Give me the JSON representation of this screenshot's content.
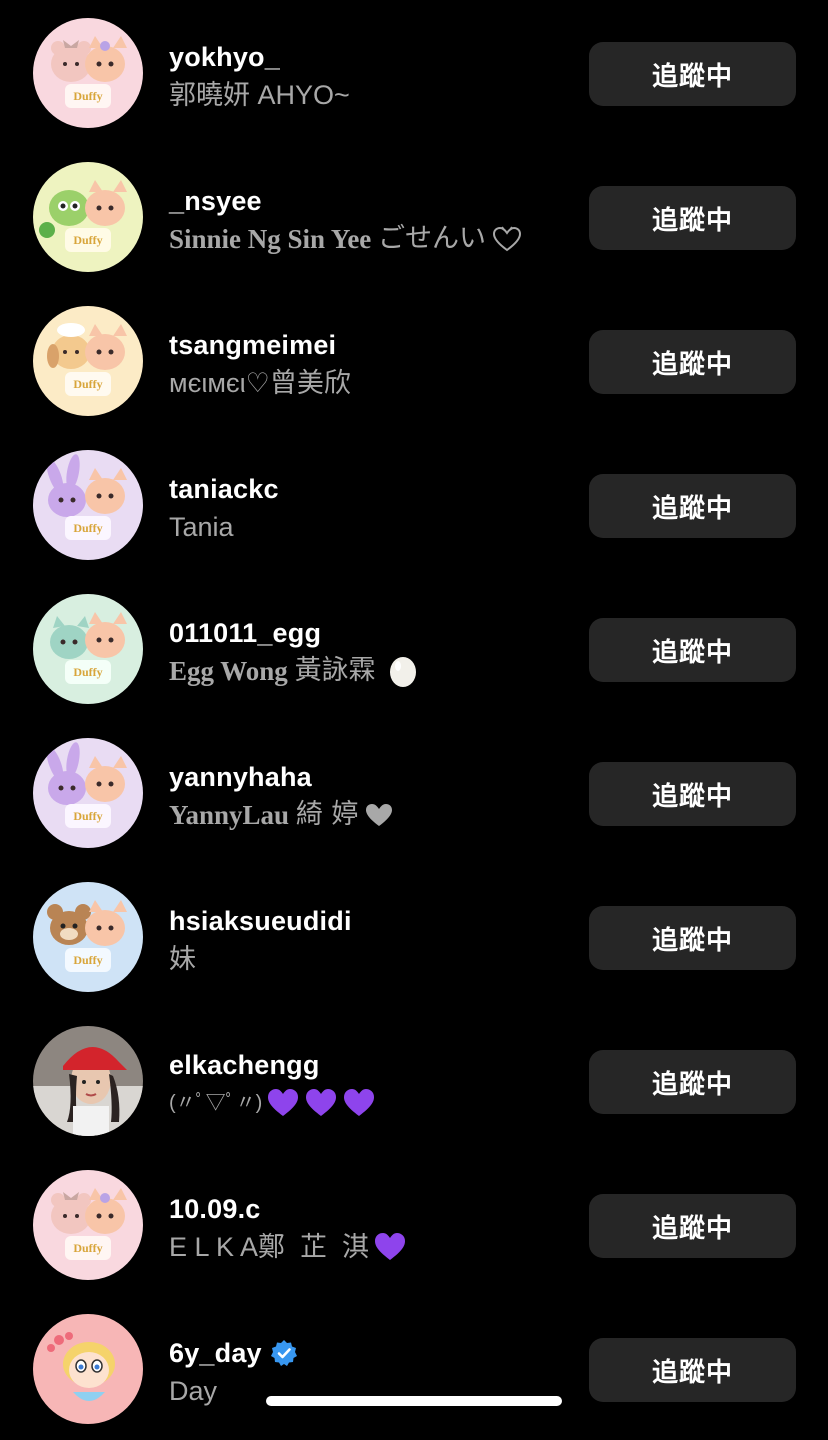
{
  "colors": {
    "background": "#000000",
    "button_bg": "#262626",
    "secondary_text": "#a8a8a8",
    "verified_blue": "#3897f0",
    "heart_purple": "#8e44ec",
    "heart_grey": "#a8a8a8"
  },
  "following_list": [
    {
      "username": "yokhyo_",
      "full_name": "郭曉妍 AHYO~",
      "button": "追蹤中",
      "avatar": "duffy-friends-pink-bear-avatar"
    },
    {
      "username": "_nsyee",
      "full_name_latin": "Sinnie Ng Sin Yee",
      "full_name_cjk": "ごせんい",
      "button": "追蹤中",
      "avatar": "duffy-friends-green-turtle-avatar",
      "suffix_icon": "outline-heart-icon"
    },
    {
      "username": "tsangmeimei",
      "full_name": "мєιмєι♡曾美欣",
      "button": "追蹤中",
      "avatar": "duffy-friends-cookie-dog-avatar"
    },
    {
      "username": "taniackc",
      "full_name": "Tania",
      "button": "追蹤中",
      "avatar": "duffy-friends-stellalou-avatar"
    },
    {
      "username": "011011_egg",
      "full_name_latin": "Egg Wong",
      "full_name_cjk": "黃詠霖",
      "button": "追蹤中",
      "avatar": "duffy-friends-gelatoni-avatar",
      "suffix_icon": "egg-icon"
    },
    {
      "username": "yannyhaha",
      "full_name_latin": "YannyLau",
      "full_name_cjk": "綺 婷",
      "button": "追蹤中",
      "avatar": "duffy-friends-stellalou-avatar",
      "suffix_icon": "grey-heart-icon"
    },
    {
      "username": "hsiaksueudidi",
      "full_name": "妹",
      "button": "追蹤中",
      "avatar": "duffy-friends-duffy-avatar"
    },
    {
      "username": "elkachengg",
      "full_name": "(〃ﾟ▽ﾟ〃)",
      "button": "追蹤中",
      "avatar": "person-red-cap-photo-avatar",
      "suffix_icon": "purple-heart-icon"
    },
    {
      "username": "10.09.c",
      "full_name": "E L K A鄭  芷  淇",
      "button": "追蹤中",
      "avatar": "duffy-friends-pink-bear-avatar",
      "suffix_icon": "purple-heart-icon"
    },
    {
      "username": "6y_day",
      "full_name": "Day",
      "button": "追蹤中",
      "avatar": "powerpuff-girl-avatar",
      "verified": true
    }
  ]
}
